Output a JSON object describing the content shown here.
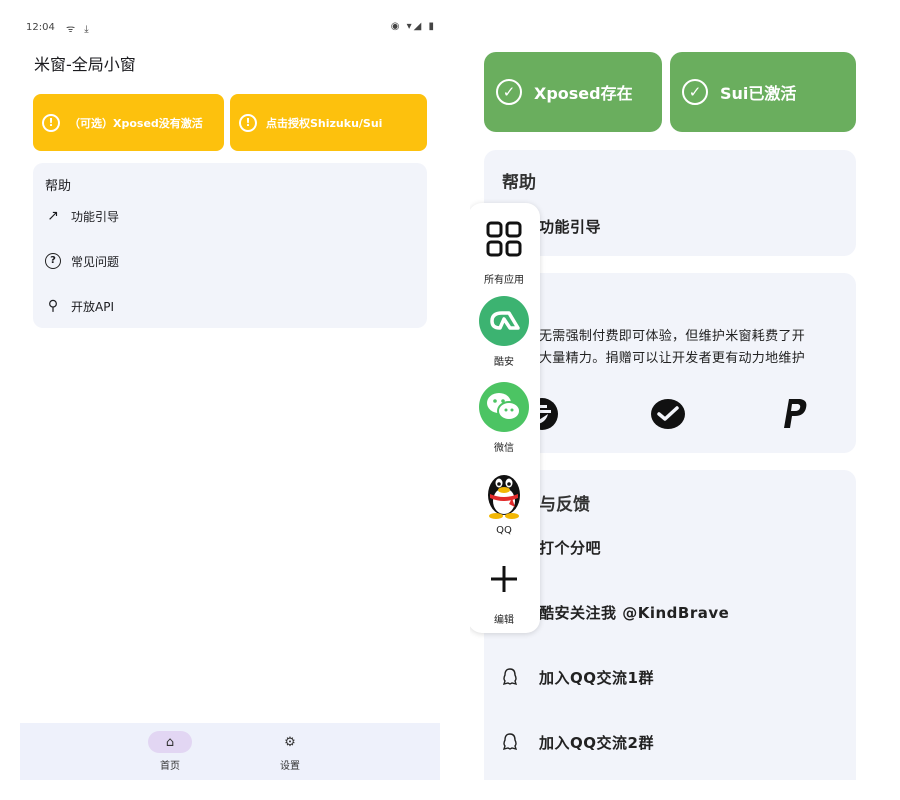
{
  "left": {
    "status": {
      "time": "12:04",
      "left_icons": "ᯤ ⤓",
      "right_icons": "◉ ▾◢ ▮"
    },
    "app_title": "米窗-全局小窗",
    "warnings": [
      {
        "icon": "!",
        "label": "（可选）Xposed没有激活"
      },
      {
        "icon": "!",
        "label": "点击授权Shizuku/Sui"
      }
    ],
    "help": {
      "title": "帮助",
      "items": [
        {
          "icon": "↗",
          "label": "功能引导"
        },
        {
          "icon": "?",
          "label": "常见问题"
        },
        {
          "icon": "⚲",
          "label": "开放API"
        }
      ]
    },
    "nav": [
      {
        "icon": "⌂",
        "label": "首页"
      },
      {
        "icon": "⚙",
        "label": "设置"
      }
    ]
  },
  "right": {
    "status_cards": [
      {
        "icon": "✓",
        "label": "Xposed存在"
      },
      {
        "icon": "✓",
        "label": "Sui已激活"
      }
    ],
    "help": {
      "title": "帮助",
      "item": "功能引导"
    },
    "donate": {
      "line1": "无需强制付费即可体验，但维护米窗耗费了开",
      "line2": "大量精力。捐赠可以让开发者更有动力地维护"
    },
    "feedback": {
      "title": "与反馈",
      "items": [
        "打个分吧",
        "酷安关注我 @KindBrave",
        "加入QQ交流1群",
        "加入QQ交流2群"
      ]
    },
    "dock": [
      {
        "label": "所有应用",
        "icon": "grid-icon"
      },
      {
        "label": "酷安",
        "icon": "coolapk-icon"
      },
      {
        "label": "微信",
        "icon": "wechat-icon"
      },
      {
        "label": "QQ",
        "icon": "qq-penguin-icon"
      },
      {
        "label": "编辑",
        "icon": "plus-icon"
      }
    ]
  },
  "colors": {
    "warning": "#fdc10d",
    "success": "#6aae5e",
    "card": "#f2f4fa",
    "nav_active": "#e2d6f3",
    "coolapk": "#3cb371",
    "wechat": "#4cc463"
  }
}
